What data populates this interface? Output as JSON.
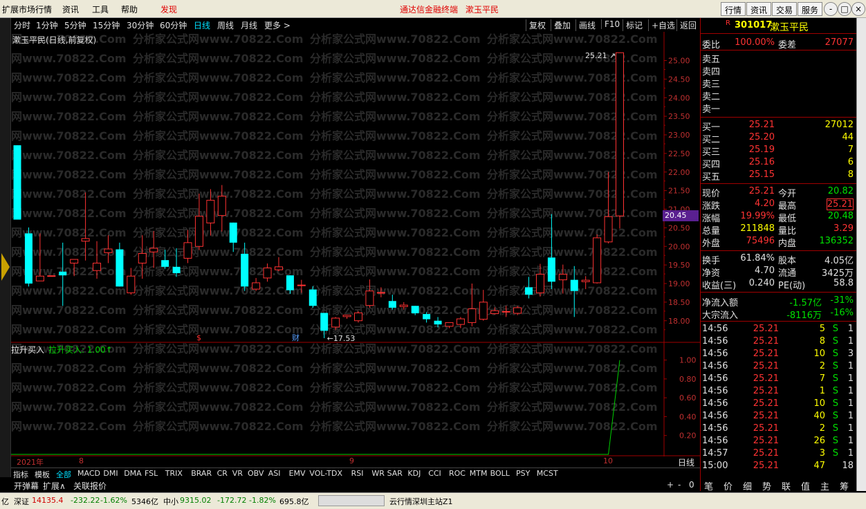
{
  "menubar": {
    "items": [
      "扩展市场行情",
      "资讯",
      "工具",
      "帮助",
      "发现"
    ],
    "center_title": "通达信金融终端",
    "center_stock": "漱玉平民",
    "right_buttons": [
      "行情",
      "资讯",
      "交易",
      "服务"
    ],
    "win_buttons": [
      "-",
      "□",
      "×"
    ]
  },
  "periodbar": {
    "periods": [
      "分时",
      "1分钟",
      "5分钟",
      "15分钟",
      "30分钟",
      "60分钟",
      "日线",
      "周线",
      "月线",
      "更多 >"
    ],
    "active": "日线",
    "tools": [
      "复权",
      "叠加",
      "画线",
      "F10",
      "标记",
      "+自选",
      "返回"
    ]
  },
  "chart": {
    "title": "漱玉平民(日线,前复权)",
    "indicator_title": "拉升买入",
    "indicator_value": "拉升买入: 1.00↑",
    "watermark": "分析家公式网www.70822.Com",
    "high_label": "25.21",
    "low_label": "17.53",
    "marker_s": "$",
    "marker_cai": "财",
    "current_price_box": "20.45",
    "dates": [
      "2021年",
      "8",
      "9",
      "10"
    ],
    "period_label": "日线"
  },
  "chart_data": {
    "type": "candlestick",
    "price_axis": {
      "ticks": [
        "25.00",
        "24.50",
        "24.00",
        "23.50",
        "23.00",
        "22.50",
        "22.00",
        "21.50",
        "21.00",
        "20.50",
        "20.00",
        "19.50",
        "19.00",
        "18.50",
        "18.00"
      ],
      "range": [
        17.4,
        25.4
      ]
    },
    "indicator_axis": {
      "ticks": [
        "1.00",
        "0.80",
        "0.60",
        "0.40",
        "0.20"
      ],
      "range": [
        0,
        1.1
      ]
    },
    "candles": [
      {
        "o": 22.72,
        "c": 20.72,
        "h": 22.72,
        "l": 20.72
      },
      {
        "o": 20.35,
        "c": 19.0,
        "h": 20.51,
        "l": 18.92
      },
      {
        "o": 19.07,
        "c": 19.2,
        "h": 20.35,
        "l": 19.07
      },
      {
        "o": 19.2,
        "c": 19.21,
        "h": 19.2,
        "l": 19.2
      },
      {
        "o": 19.32,
        "c": 19.22,
        "h": 20.1,
        "l": 18.4
      },
      {
        "o": 19.55,
        "c": 19.65,
        "h": 19.65,
        "l": 19.2
      },
      {
        "o": 20.14,
        "c": 20.21,
        "h": 21.45,
        "l": 19.62
      },
      {
        "o": 19.35,
        "c": 19.55,
        "h": 20.14,
        "l": 19.13
      },
      {
        "o": 19.83,
        "c": 19.93,
        "h": 20.3,
        "l": 19.55
      },
      {
        "o": 19.92,
        "c": 18.92,
        "h": 20.1,
        "l": 18.92
      },
      {
        "o": 18.75,
        "c": 19.2,
        "h": 19.42,
        "l": 18.7
      },
      {
        "o": 19.55,
        "c": 19.81,
        "h": 20.3,
        "l": 19.13
      },
      {
        "o": 19.85,
        "c": 19.95,
        "h": 20.41,
        "l": 19.42
      },
      {
        "o": 19.63,
        "c": 19.45,
        "h": 19.91,
        "l": 19.4
      },
      {
        "o": 19.45,
        "c": 19.28,
        "h": 19.95,
        "l": 19.18
      },
      {
        "o": 19.68,
        "c": 20.1,
        "h": 20.44,
        "l": 19.55
      },
      {
        "o": 20.0,
        "c": 20.81,
        "h": 21.42,
        "l": 19.9
      },
      {
        "o": 20.63,
        "c": 21.24,
        "h": 21.54,
        "l": 20.29
      },
      {
        "o": 20.83,
        "c": 21.35,
        "h": 21.65,
        "l": 20.4
      },
      {
        "o": 20.64,
        "c": 20.1,
        "h": 20.64,
        "l": 19.85
      },
      {
        "o": 19.8,
        "c": 18.92,
        "h": 20.1,
        "l": 18.8
      },
      {
        "o": 18.85,
        "c": 19.02,
        "h": 19.15,
        "l": 18.8
      },
      {
        "o": 19.15,
        "c": 19.42,
        "h": 19.54,
        "l": 19.05
      },
      {
        "o": 19.37,
        "c": 19.45,
        "h": 19.71,
        "l": 19.33
      },
      {
        "o": 19.22,
        "c": 18.82,
        "h": 19.22,
        "l": 18.72
      },
      {
        "o": 18.95,
        "c": 18.96,
        "h": 19.1,
        "l": 18.75
      },
      {
        "o": 18.84,
        "c": 18.4,
        "h": 18.93,
        "l": 18.35
      },
      {
        "o": 18.21,
        "c": 17.73,
        "h": 18.21,
        "l": 17.53
      },
      {
        "o": 17.83,
        "c": 18.07,
        "h": 18.1,
        "l": 17.75
      },
      {
        "o": 18.11,
        "c": 18.15,
        "h": 18.16,
        "l": 18.05
      },
      {
        "o": 18.0,
        "c": 18.21,
        "h": 18.26,
        "l": 17.95
      },
      {
        "o": 18.41,
        "c": 18.8,
        "h": 19.11,
        "l": 18.35
      },
      {
        "o": 18.75,
        "c": 18.76,
        "h": 18.9,
        "l": 18.63
      },
      {
        "o": 18.53,
        "c": 18.35,
        "h": 18.7,
        "l": 18.3
      },
      {
        "o": 18.38,
        "c": 18.42,
        "h": 18.5,
        "l": 18.3
      },
      {
        "o": 18.4,
        "c": 18.2,
        "h": 18.4,
        "l": 18.15
      },
      {
        "o": 18.18,
        "c": 18.04,
        "h": 18.23,
        "l": 17.95
      },
      {
        "o": 18.0,
        "c": 17.9,
        "h": 18.1,
        "l": 17.82
      },
      {
        "o": 17.85,
        "c": 17.95,
        "h": 17.9,
        "l": 17.8
      },
      {
        "o": 17.9,
        "c": 18.05,
        "h": 18.1,
        "l": 17.8
      },
      {
        "o": 17.95,
        "c": 18.32,
        "h": 19.0,
        "l": 17.85
      },
      {
        "o": 18.04,
        "c": 18.5,
        "h": 18.83,
        "l": 18.0
      },
      {
        "o": 18.19,
        "c": 18.27,
        "h": 18.36,
        "l": 18.17
      },
      {
        "o": 18.25,
        "c": 18.25,
        "h": 18.4,
        "l": 18.1
      },
      {
        "o": 18.2,
        "c": 18.35,
        "h": 18.4,
        "l": 18.15
      },
      {
        "o": 18.9,
        "c": 18.7,
        "h": 19.18,
        "l": 18.6
      },
      {
        "o": 18.75,
        "c": 19.25,
        "h": 19.53,
        "l": 18.65
      },
      {
        "o": 19.7,
        "c": 19.05,
        "h": 20.87,
        "l": 18.85
      },
      {
        "o": 19.1,
        "c": 19.25,
        "h": 19.51,
        "l": 18.73
      },
      {
        "o": 19.1,
        "c": 18.8,
        "h": 19.47,
        "l": 18.1
      },
      {
        "o": 19.05,
        "c": 19.09,
        "h": 19.2,
        "l": 18.85
      },
      {
        "o": 19.02,
        "c": 20.23,
        "h": 20.32,
        "l": 19.0
      },
      {
        "o": 20.12,
        "c": 20.8,
        "h": 22.0,
        "l": 20.08
      },
      {
        "o": 20.82,
        "c": 25.21,
        "h": 25.21,
        "l": 20.48
      }
    ],
    "indicator_series": {
      "name": "拉升买入",
      "values_start": 0,
      "values_end": 1.0
    }
  },
  "quote": {
    "code": "301017",
    "name": "漱玉平民",
    "r_badge": "R",
    "weibi_label": "委比",
    "weibi": "100.00%",
    "weicha_label": "委差",
    "weicha": "27077",
    "sell": [
      {
        "label": "卖五"
      },
      {
        "label": "卖四"
      },
      {
        "label": "卖三"
      },
      {
        "label": "卖二"
      },
      {
        "label": "卖一"
      }
    ],
    "buy": [
      {
        "label": "买一",
        "price": "25.21",
        "vol": "27012"
      },
      {
        "label": "买二",
        "price": "25.20",
        "vol": "44"
      },
      {
        "label": "买三",
        "price": "25.19",
        "vol": "7"
      },
      {
        "label": "买四",
        "price": "25.16",
        "vol": "6"
      },
      {
        "label": "买五",
        "price": "25.15",
        "vol": "8"
      }
    ],
    "stats": [
      {
        "l1": "现价",
        "v1": "25.21",
        "c1": "red",
        "l2": "今开",
        "v2": "20.82",
        "c2": "grn"
      },
      {
        "l1": "涨跌",
        "v1": "4.20",
        "c1": "red",
        "l2": "最高",
        "v2": "25.21",
        "c2": "red"
      },
      {
        "l1": "涨幅",
        "v1": "19.99%",
        "c1": "red",
        "l2": "最低",
        "v2": "20.48",
        "c2": "grn"
      },
      {
        "l1": "总量",
        "v1": "211848",
        "c1": "yel",
        "l2": "量比",
        "v2": "3.29",
        "c2": "red"
      },
      {
        "l1": "外盘",
        "v1": "75496",
        "c1": "red",
        "l2": "内盘",
        "v2": "136352",
        "c2": "grn"
      }
    ],
    "stats2": [
      {
        "l1": "换手",
        "v1": "61.84%",
        "l2": "股本",
        "v2": "4.05亿"
      },
      {
        "l1": "净资",
        "v1": "4.70",
        "l2": "流通",
        "v2": "3425万"
      },
      {
        "l1": "收益(三)",
        "v1": "0.240",
        "l2": "PE(动)",
        "v2": "58.8"
      }
    ],
    "flows": [
      {
        "l": "净流入额",
        "v": "-1.57亿",
        "p": "-31%"
      },
      {
        "l": "大宗流入",
        "v": "-8116万",
        "p": "-16%"
      }
    ],
    "ticks": [
      {
        "t": "14:56",
        "p": "25.21",
        "v": "5",
        "s": "S",
        "n": "1"
      },
      {
        "t": "14:56",
        "p": "25.21",
        "v": "8",
        "s": "S",
        "n": "1"
      },
      {
        "t": "14:56",
        "p": "25.21",
        "v": "10",
        "s": "S",
        "n": "3"
      },
      {
        "t": "14:56",
        "p": "25.21",
        "v": "2",
        "s": "S",
        "n": "1"
      },
      {
        "t": "14:56",
        "p": "25.21",
        "v": "7",
        "s": "S",
        "n": "1"
      },
      {
        "t": "14:56",
        "p": "25.21",
        "v": "1",
        "s": "S",
        "n": "1"
      },
      {
        "t": "14:56",
        "p": "25.21",
        "v": "10",
        "s": "S",
        "n": "1"
      },
      {
        "t": "14:56",
        "p": "25.21",
        "v": "40",
        "s": "S",
        "n": "1"
      },
      {
        "t": "14:56",
        "p": "25.21",
        "v": "2",
        "s": "S",
        "n": "1"
      },
      {
        "t": "14:56",
        "p": "25.21",
        "v": "26",
        "s": "S",
        "n": "1"
      },
      {
        "t": "14:57",
        "p": "25.21",
        "v": "3",
        "s": "S",
        "n": "1"
      },
      {
        "t": "15:00",
        "p": "25.21",
        "v": "47",
        "s": "",
        "n": "18"
      }
    ],
    "bottom_tabs": [
      "笔",
      "价",
      "细",
      "势",
      "联",
      "值",
      "主",
      "筹"
    ]
  },
  "indicator_tabs": [
    "指标",
    "模板",
    "全部",
    "MACD",
    "DMI",
    "DMA",
    "FSL",
    "TRIX",
    "BRAR",
    "CR",
    "VR",
    "OBV",
    "ASI",
    "EMV",
    "VOL-TDX",
    "RSI",
    "WR",
    "SAR",
    "KDJ",
    "CCI",
    "ROC",
    "MTM",
    "BOLL",
    "PSY",
    "MCST"
  ],
  "indicator_active": "全部",
  "tabs2": [
    "开弹幕",
    "扩展∧",
    "关联报价"
  ],
  "zoom": [
    "+",
    "-",
    "0"
  ],
  "status": {
    "p1": "亿",
    "sz_label": "深证",
    "sz": "14135.4",
    "sz_chg": "-232.22",
    "sz_pct": "-1.62%",
    "sz_amt": "5346亿",
    "zx_label": "中小",
    "zx": "9315.02",
    "zx_chg": "-172.72",
    "zx_pct": "-1.82%",
    "zx_amt": "695.8亿",
    "server": "云行情深圳主站Z1"
  },
  "colors": {
    "up": "#ff3232",
    "down": "#00ffff",
    "grid": "#a00000"
  }
}
